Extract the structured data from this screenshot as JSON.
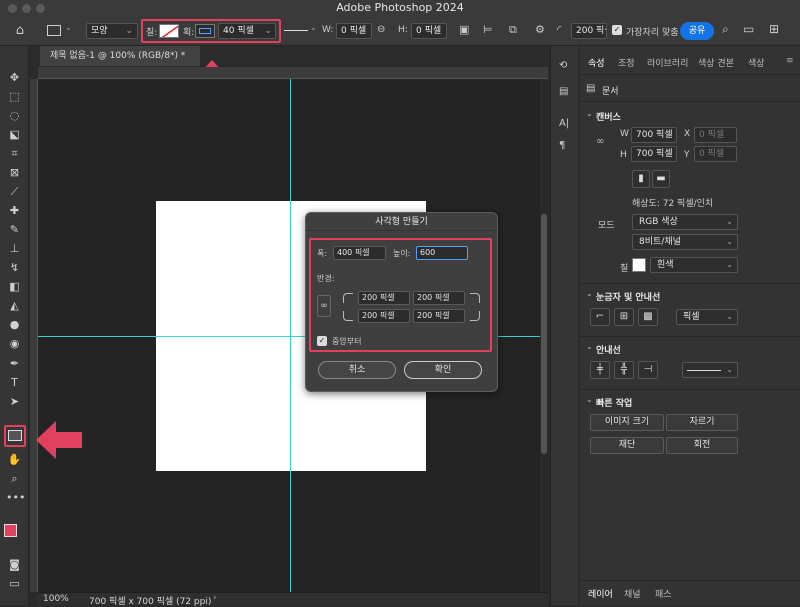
{
  "app_title": "Adobe Photoshop 2024",
  "options_bar": {
    "shape_mode": "모양",
    "fill_label": "칠:",
    "stroke_label": "획:",
    "stroke_width": "40 픽셀",
    "w_label": "W:",
    "w_value": "0 픽셀",
    "h_label": "H:",
    "h_value": "0 픽셀",
    "radius_value": "200 픽셀",
    "align_edges_label": "가장자리 맞춤",
    "share_label": "공유"
  },
  "document": {
    "tab_title": "제목 없음-1 @ 100% (RGB/8*) *",
    "zoom": "100%",
    "size_info": "700 픽셀 x 700 픽셀 (72 ppi)"
  },
  "dialog": {
    "title": "사각형 만들기",
    "width_label": "폭:",
    "width_value": "400 픽셀",
    "height_label": "높이:",
    "height_value": "600",
    "radius_label": "반경:",
    "radius_tl": "200 픽셀",
    "radius_tr": "200 픽셀",
    "radius_bl": "200 픽셀",
    "radius_br": "200 픽셀",
    "from_center_label": "중앙부터",
    "from_center_checked": true,
    "cancel_label": "취소",
    "ok_label": "확인"
  },
  "panel": {
    "tabs": [
      "속성",
      "조정",
      "라이브러리",
      "색상 견본",
      "색상"
    ],
    "doc_label": "문서",
    "canvas_section": "캔버스",
    "w_label": "W",
    "w_value": "700 픽셀",
    "x_label": "X",
    "x_value": "0 픽셀",
    "h_label": "H",
    "h_value": "700 픽셀",
    "y_label": "Y",
    "y_value": "0 픽셀",
    "resolution": "해상도: 72 픽셀/인치",
    "mode_label": "모드",
    "mode_value": "RGB 색상",
    "bit_value": "8비트/채널",
    "fill_label": "칠",
    "fill_value": "흰색",
    "rulers_section": "눈금자 및 안내선",
    "ruler_unit": "픽셀",
    "guides_section": "안내선",
    "quick_section": "빠른 작업",
    "image_size_btn": "이미지 크기",
    "crop_btn": "자르기",
    "trim_btn": "재단",
    "rotate_btn": "회전",
    "bottom_tabs": [
      "레이어",
      "채널",
      "패스"
    ]
  },
  "colors": {
    "highlight": "#e2405f",
    "accent": "#1473e6",
    "guide": "#39d0d8",
    "foreground": "#e2405f",
    "background": "#ffffff"
  }
}
